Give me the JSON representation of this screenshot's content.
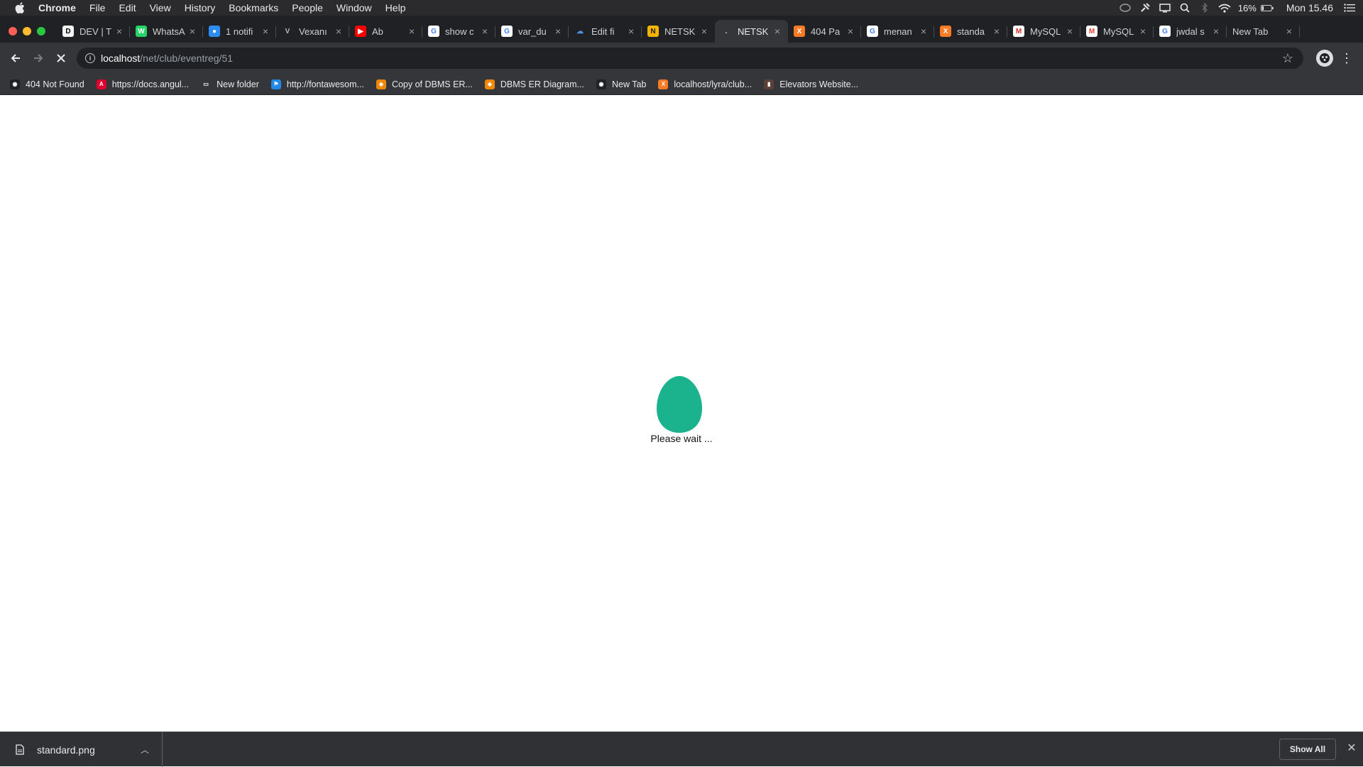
{
  "menubar": {
    "app": "Chrome",
    "items": [
      "File",
      "Edit",
      "View",
      "History",
      "Bookmarks",
      "People",
      "Window",
      "Help"
    ],
    "battery": "16%",
    "clock": "Mon 15.46"
  },
  "tabs": [
    {
      "title": "DEV | T",
      "favicon": "dev-icon",
      "color": "#f5f5f5",
      "text_color": "#000000",
      "glyph": "D"
    },
    {
      "title": "WhatsA",
      "favicon": "whatsapp-icon",
      "color": "#25d366",
      "text_color": "#ffffff",
      "glyph": "W"
    },
    {
      "title": "1 notifi",
      "favicon": "chat-icon",
      "color": "#2d8cf0",
      "text_color": "#ffffff",
      "glyph": "●"
    },
    {
      "title": "Vexanı",
      "favicon": "vexan-icon",
      "color": "#202124",
      "text_color": "#bbbbbb",
      "glyph": "V"
    },
    {
      "title": "Ab",
      "favicon": "youtube-icon",
      "color": "#ff0000",
      "text_color": "#ffffff",
      "glyph": "▶"
    },
    {
      "title": "show c",
      "favicon": "google-icon",
      "color": "#ffffff",
      "text_color": "#4285f4",
      "glyph": "G"
    },
    {
      "title": "var_du",
      "favicon": "google-icon",
      "color": "#ffffff",
      "text_color": "#4285f4",
      "glyph": "G"
    },
    {
      "title": "Edit fi",
      "favicon": "cloud-icon",
      "color": "#202124",
      "text_color": "#4a90d9",
      "glyph": "☁"
    },
    {
      "title": "NETSK",
      "favicon": "netsk-icon",
      "color": "#f4b400",
      "text_color": "#202124",
      "glyph": "N"
    },
    {
      "title": "NETSK",
      "favicon": "netsk-loading-icon",
      "color": "#35363a",
      "text_color": "#e8eaed",
      "glyph": "."
    },
    {
      "title": "404 Pa",
      "favicon": "xampp-icon",
      "color": "#fb7a24",
      "text_color": "#ffffff",
      "glyph": "X"
    },
    {
      "title": "menan",
      "favicon": "google-icon",
      "color": "#ffffff",
      "text_color": "#4285f4",
      "glyph": "G"
    },
    {
      "title": "standa",
      "favicon": "xampp-icon",
      "color": "#fb7a24",
      "text_color": "#ffffff",
      "glyph": "X"
    },
    {
      "title": "MySQL",
      "favicon": "mysql-icon",
      "color": "#ffffff",
      "text_color": "#d32f2f",
      "glyph": "M"
    },
    {
      "title": "MySQL",
      "favicon": "gmail-icon",
      "color": "#ffffff",
      "text_color": "#ea4335",
      "glyph": "M"
    },
    {
      "title": "jwdal s",
      "favicon": "google-icon",
      "color": "#ffffff",
      "text_color": "#4285f4",
      "glyph": "G"
    },
    {
      "title": "New Tab",
      "favicon": "",
      "color": "",
      "text_color": "",
      "glyph": ""
    }
  ],
  "active_tab_index": 9,
  "address": {
    "host": "localhost",
    "path": "/net/club/eventreg/51"
  },
  "bookmarks": [
    {
      "label": "404 Not Found",
      "icon": "globe-icon",
      "color": "#202124",
      "glyph": "◉"
    },
    {
      "label": "https://docs.angul...",
      "icon": "angular-icon",
      "color": "#dd0031",
      "glyph": "A"
    },
    {
      "label": "New folder",
      "icon": "folder-icon",
      "color": "#35363a",
      "glyph": "▭"
    },
    {
      "label": "http://fontawesom...",
      "icon": "fontawesome-icon",
      "color": "#228ae6",
      "glyph": "⚑"
    },
    {
      "label": "Copy of DBMS ER...",
      "icon": "drawio-icon",
      "color": "#f08705",
      "glyph": "◈"
    },
    {
      "label": "DBMS ER Diagram...",
      "icon": "drawio-icon",
      "color": "#f08705",
      "glyph": "◈"
    },
    {
      "label": "New Tab",
      "icon": "globe-icon",
      "color": "#202124",
      "glyph": "◉"
    },
    {
      "label": "localhost/lyra/club...",
      "icon": "xampp-icon",
      "color": "#fb7a24",
      "glyph": "X"
    },
    {
      "label": "Elevators Website...",
      "icon": "elevator-icon",
      "color": "#5d4037",
      "glyph": "▮"
    }
  ],
  "loader": {
    "text": "Please wait ...",
    "color": "#1bb38d"
  },
  "downloads": {
    "file": "standard.png",
    "show_all": "Show All"
  }
}
